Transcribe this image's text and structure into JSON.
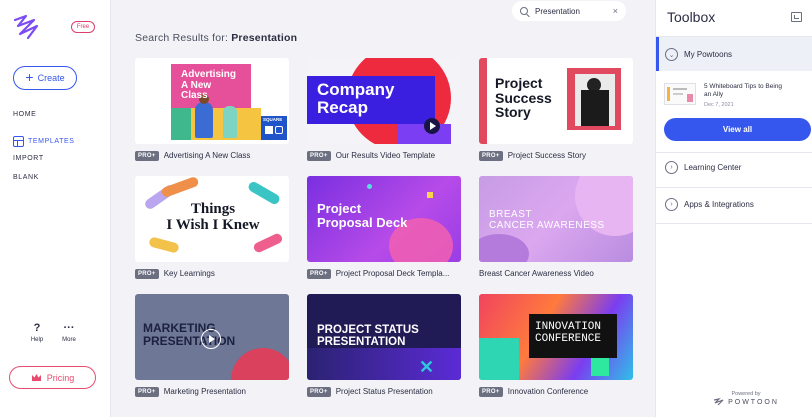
{
  "sidebar": {
    "free_badge": "Free",
    "create_label": "Create",
    "nav": [
      "HOME",
      "TEMPLATES",
      "IMPORT",
      "BLANK"
    ],
    "help_label": "Help",
    "more_label": "More",
    "pricing_label": "Pricing"
  },
  "search": {
    "value": "Presentation",
    "clear": "×"
  },
  "results": {
    "prefix": "Search Results for:",
    "query": "Presentation"
  },
  "badge": "PRO+",
  "templates": [
    {
      "title": "Advertising A New Class",
      "pro": true,
      "thumb_text": [
        "Advertising",
        "A New",
        "Class"
      ],
      "thumb_extra": "SQUARE"
    },
    {
      "title": "Our Results Video Template",
      "pro": true,
      "thumb_text": [
        "Company",
        "Recap"
      ]
    },
    {
      "title": "Project Success Story",
      "pro": true,
      "thumb_text": [
        "Project",
        "Success",
        "Story"
      ]
    },
    {
      "title": "Key Learnings",
      "pro": true,
      "thumb_text": [
        "Things",
        "I Wish I Knew"
      ]
    },
    {
      "title": "Project Proposal Deck Templa...",
      "pro": true,
      "thumb_text": [
        "Project",
        "Proposal Deck"
      ]
    },
    {
      "title": "Breast Cancer Awareness Video",
      "pro": false,
      "thumb_text": [
        "BREAST",
        "CANCER AWARENESS"
      ]
    },
    {
      "title": "Marketing Presentation",
      "pro": true,
      "thumb_text": [
        "MARKETING",
        "PRESENTATION"
      ]
    },
    {
      "title": "Project Status Presentation",
      "pro": true,
      "thumb_text": [
        "PROJECT STATUS",
        "PRESENTATION"
      ]
    },
    {
      "title": "Innovation Conference",
      "pro": true,
      "thumb_text": [
        "INNOVATION",
        "CONFERENCE"
      ]
    }
  ],
  "toolbox": {
    "title": "Toolbox",
    "my_powtoons": "My Powtoons",
    "recent_title": "5 Whiteboard Tips to Being an Ally",
    "recent_date": "Dec 7, 2021",
    "view_all": "View all",
    "learning_center": "Learning Center",
    "apps": "Apps & Integrations",
    "powered_by": "Powered by",
    "brand": "POWTOON"
  },
  "colors": {
    "accent": "#3657ee",
    "pricing": "#e74c6f",
    "main_bg": "#f3f3f7"
  }
}
